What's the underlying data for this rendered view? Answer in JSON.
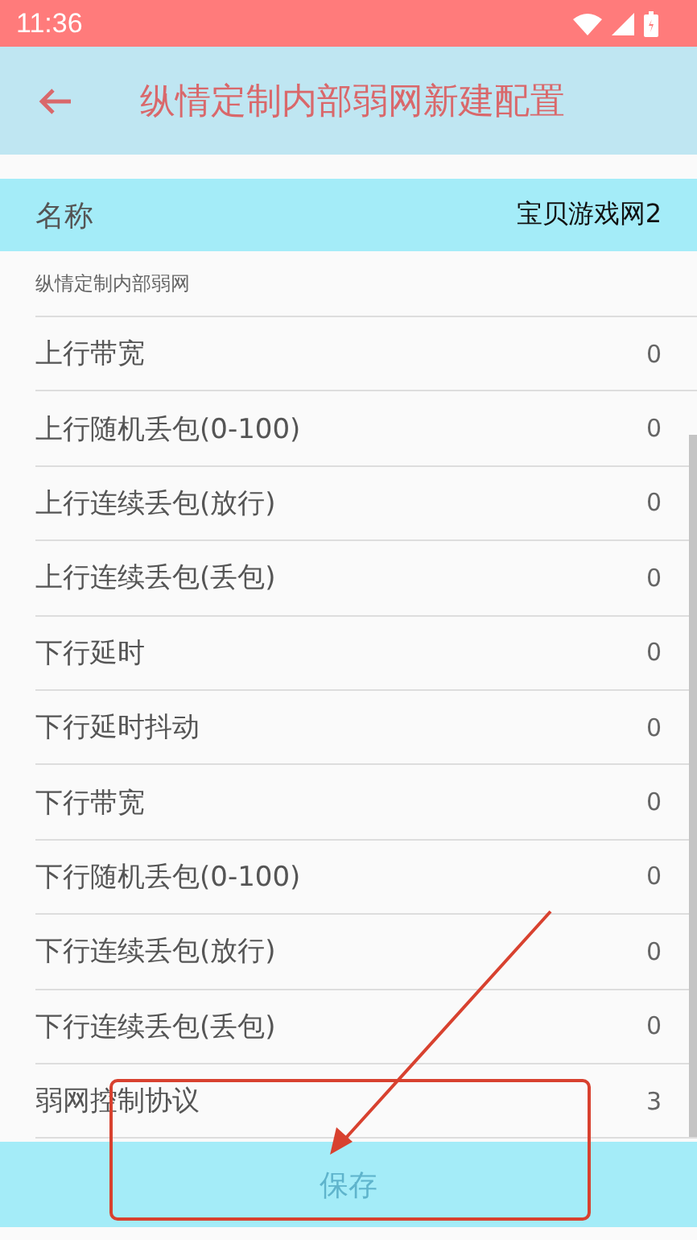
{
  "status_bar": {
    "time": "11:36"
  },
  "toolbar": {
    "title": "纵情定制内部弱网新建配置"
  },
  "name_row": {
    "label": "名称",
    "value": "宝贝游戏网2"
  },
  "section": {
    "label": "纵情定制内部弱网"
  },
  "rows": [
    {
      "label": "上行带宽",
      "value": "0"
    },
    {
      "label": "上行随机丢包(0-100)",
      "value": "0"
    },
    {
      "label": "上行连续丢包(放行)",
      "value": "0"
    },
    {
      "label": "上行连续丢包(丢包)",
      "value": "0"
    },
    {
      "label": "下行延时",
      "value": "0"
    },
    {
      "label": "下行延时抖动",
      "value": "0"
    },
    {
      "label": "下行带宽",
      "value": "0"
    },
    {
      "label": "下行随机丢包(0-100)",
      "value": "0"
    },
    {
      "label": "下行连续丢包(放行)",
      "value": "0"
    },
    {
      "label": "下行连续丢包(丢包)",
      "value": "0"
    },
    {
      "label": "弱网控制协议",
      "value": "3"
    }
  ],
  "save_button": {
    "label": "保存",
    "disabled": true
  }
}
